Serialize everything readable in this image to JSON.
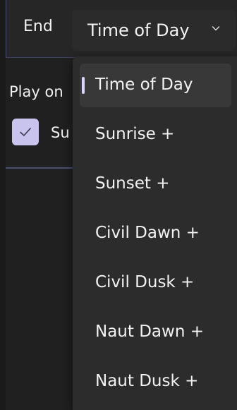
{
  "end_field": {
    "label": "End",
    "selected_value": "Time of Day"
  },
  "play_on": {
    "label": "Play on",
    "checkbox_label_partial": "Su",
    "checked": true
  },
  "menu": {
    "items": [
      {
        "label": "Time of Day",
        "selected": true
      },
      {
        "label": "Sunrise +",
        "selected": false
      },
      {
        "label": "Sunset +",
        "selected": false
      },
      {
        "label": "Civil Dawn +",
        "selected": false
      },
      {
        "label": "Civil Dusk +",
        "selected": false
      },
      {
        "label": "Naut Dawn +",
        "selected": false
      },
      {
        "label": "Naut Dusk +",
        "selected": false
      }
    ]
  },
  "icons": {
    "chevron": "chevron-down-icon",
    "check": "checkmark-icon"
  },
  "colors": {
    "accent": "#c8c4ee",
    "panel_border": "#4a4f7a",
    "menu_bg": "#2c2c2c",
    "selected_bg": "#383838"
  }
}
